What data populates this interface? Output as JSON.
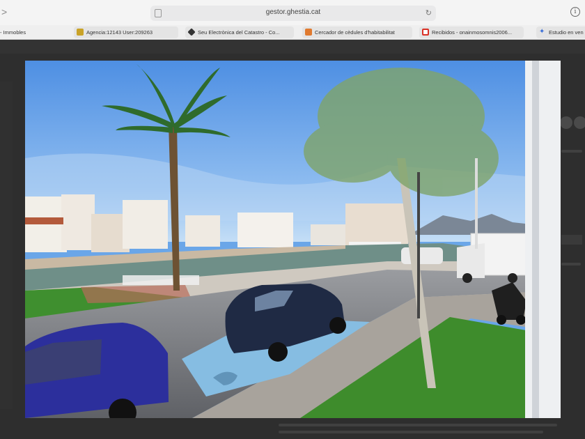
{
  "browser": {
    "url": "gestor.ghestia.cat",
    "back_glyph": ">",
    "info_glyph": "i",
    "reload_glyph": "↻"
  },
  "bookmarks": [
    {
      "label": "- Immobles",
      "icon": "none"
    },
    {
      "label": "Agencia:12143 User:209263",
      "icon": "gold-badge-icon",
      "color": "#c9a227"
    },
    {
      "label": "Seu Electrònica del Catastro - Co...",
      "icon": "catastro-icon",
      "color": "#333333"
    },
    {
      "label": "Cercador de cèdules d'habitabilitat",
      "icon": "habitabilitat-icon",
      "color": "#e07a2f"
    },
    {
      "label": "Recibidos - onainmosomnis2006...",
      "icon": "gmail-icon",
      "color": "#d93025"
    },
    {
      "label": "Estudio en ven",
      "icon": "star-icon",
      "color": "#3b6fd8"
    }
  ],
  "lightbox": {
    "photo_subject": "street-view-marina-photo",
    "colors": {
      "sky": "#5c9ae6",
      "sky_light": "#a9cdf2",
      "grass": "#3f8f2f",
      "road": "#7a7c80",
      "parking_blue": "#7fb6de",
      "car_dark": "#1f2a44",
      "car_blue": "#2c2f9c",
      "water": "#6a8a85"
    }
  }
}
